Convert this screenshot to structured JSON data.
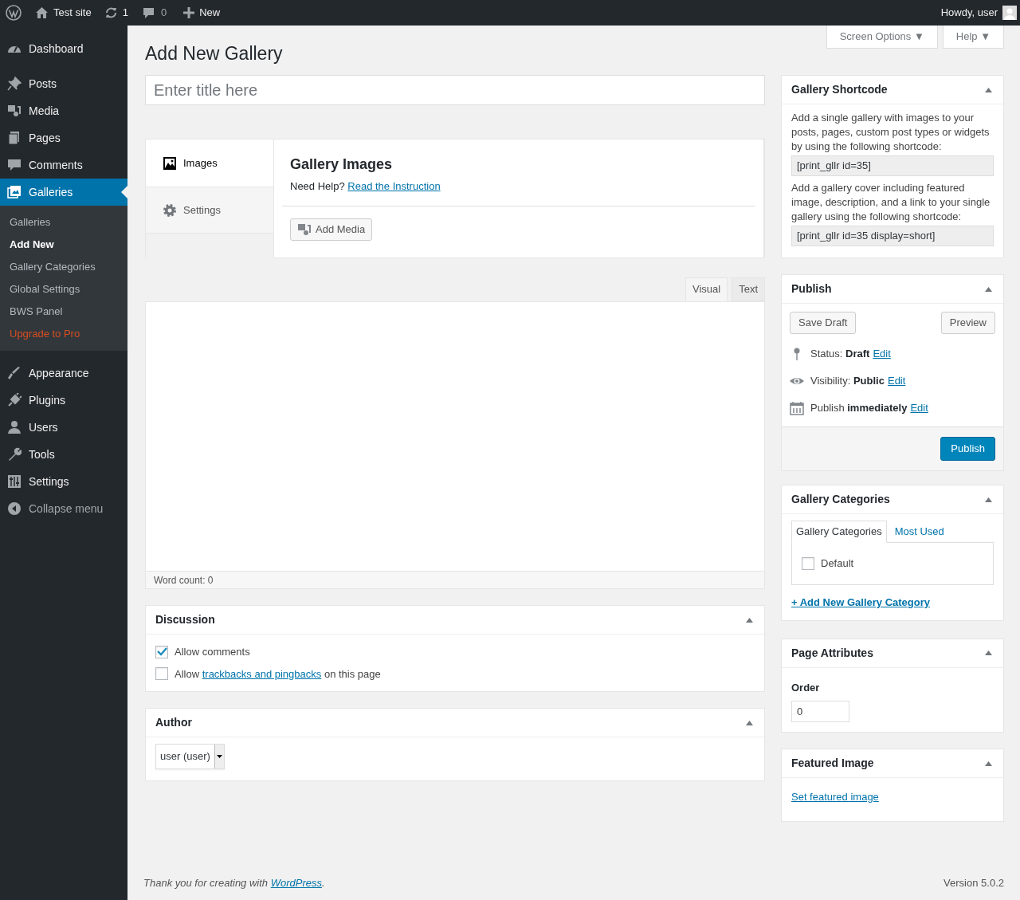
{
  "admin_bar": {
    "site": "Test site",
    "updates": "1",
    "comments": "0",
    "new": "New",
    "howdy": "Howdy, user"
  },
  "sidebar": {
    "items": [
      {
        "label": "Dashboard",
        "selected": false
      },
      {
        "label": "Posts",
        "selected": false
      },
      {
        "label": "Media",
        "selected": false
      },
      {
        "label": "Pages",
        "selected": false
      },
      {
        "label": "Comments",
        "selected": false
      },
      {
        "label": "Galleries",
        "selected": true,
        "children": [
          {
            "label": "Galleries",
            "selected": false,
            "kind": "link"
          },
          {
            "label": "Add New",
            "selected": true,
            "kind": "link"
          },
          {
            "label": "Gallery Categories",
            "selected": false,
            "kind": "link"
          },
          {
            "label": "Global Settings",
            "selected": false,
            "kind": "link"
          },
          {
            "label": "BWS Panel",
            "selected": false,
            "kind": "link"
          },
          {
            "label": "Upgrade to Pro",
            "selected": false,
            "kind": "upgrade"
          }
        ]
      },
      {
        "label": "Appearance",
        "selected": false
      },
      {
        "label": "Plugins",
        "selected": false
      },
      {
        "label": "Users",
        "selected": false
      },
      {
        "label": "Tools",
        "selected": false
      },
      {
        "label": "Settings",
        "selected": false
      },
      {
        "label": "Collapse menu",
        "selected": false
      }
    ]
  },
  "header": {
    "title": "Add New Gallery",
    "screen_options": "Screen Options ▼",
    "help": "Help ▼"
  },
  "title_field": {
    "placeholder": "Enter title here"
  },
  "gallery_box": {
    "tabs": [
      {
        "label": "Images",
        "selected": true
      },
      {
        "label": "Settings",
        "selected": false
      }
    ],
    "heading": "Gallery Images",
    "help_text": "Need Help?",
    "help_link": "Read the Instruction",
    "add_media": "Add Media"
  },
  "editor": {
    "tabs": [
      {
        "label": "Visual",
        "selected": true
      },
      {
        "label": "Text",
        "selected": false
      }
    ],
    "word_count": "Word count: 0"
  },
  "discussion": {
    "title": "Discussion",
    "options": [
      {
        "before": "Allow comments",
        "checked": true
      },
      {
        "before": "Allow",
        "link": "trackbacks and pingbacks",
        "after": "on this page",
        "checked": false
      }
    ]
  },
  "author": {
    "title": "Author",
    "value": "user (user)"
  },
  "shortcode_box": {
    "title": "Gallery Shortcode",
    "text_1": "Add a single gallery with images to your posts, pages, custom post types or widgets by using the following shortcode:",
    "code_1": "[print_gllr id=35]",
    "text_2": "Add a gallery cover including featured image, description, and a link to your single gallery using the following shortcode:",
    "code_2": "[print_gllr id=35 display=short]"
  },
  "publish_box": {
    "title": "Publish",
    "save_draft": "Save Draft",
    "preview": "Preview",
    "rows": [
      {
        "text": "Status: **Draft**",
        "link": "Edit"
      },
      {
        "text": "Visibility: **Public**",
        "link": "Edit"
      },
      {
        "text": "Publish **immediately**",
        "link": "Edit"
      }
    ],
    "publish": "Publish"
  },
  "categories_box": {
    "title": "Gallery Categories",
    "tabs": [
      {
        "label": "Gallery Categories",
        "selected": true
      },
      {
        "label": "Most Used",
        "selected": false
      }
    ],
    "items": [
      {
        "label": "Default",
        "checked": false
      }
    ],
    "add_link": "+ Add New Gallery Category"
  },
  "page_attributes": {
    "title": "Page Attributes",
    "label": "Order",
    "value": "0"
  },
  "featured_image": {
    "title": "Featured Image",
    "link": "Set featured image"
  },
  "footer": {
    "before": "Thank you for creating with",
    "link": "WordPress",
    "after": ".",
    "version": "Version 5.0.2"
  }
}
